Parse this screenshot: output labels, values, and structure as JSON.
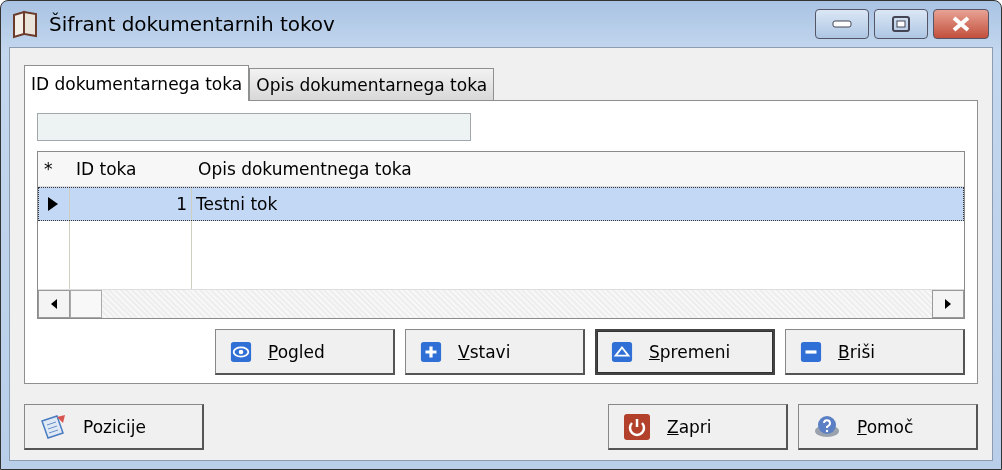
{
  "window": {
    "title": "Šifrant dokumentarnih tokov"
  },
  "tabs": [
    {
      "label": "ID dokumentarnega toka",
      "selected": true
    },
    {
      "label": "Opis dokumentarnega toka",
      "selected": false
    }
  ],
  "table": {
    "columns": [
      "*",
      "ID toka",
      "Opis dokumentnega toka"
    ],
    "rows": [
      {
        "id": "1",
        "description": "Testni tok",
        "selected": true
      }
    ]
  },
  "grid_buttons": [
    {
      "label": "Pogled",
      "kind": "view",
      "mnemonic": true,
      "focused": false
    },
    {
      "label": "Vstavi",
      "kind": "add",
      "mnemonic": true,
      "focused": false
    },
    {
      "label": "Spremeni",
      "kind": "edit",
      "mnemonic": true,
      "focused": true
    },
    {
      "label": "Briši",
      "kind": "delete",
      "mnemonic": true,
      "focused": false
    }
  ],
  "footer_buttons": [
    {
      "label": "Pozicije",
      "kind": "positions",
      "mnemonic": false,
      "focused": false
    },
    {
      "label": "Zapri",
      "kind": "close",
      "mnemonic": true,
      "focused": false
    },
    {
      "label": "Pomoč",
      "kind": "help",
      "mnemonic": true,
      "focused": false
    }
  ]
}
